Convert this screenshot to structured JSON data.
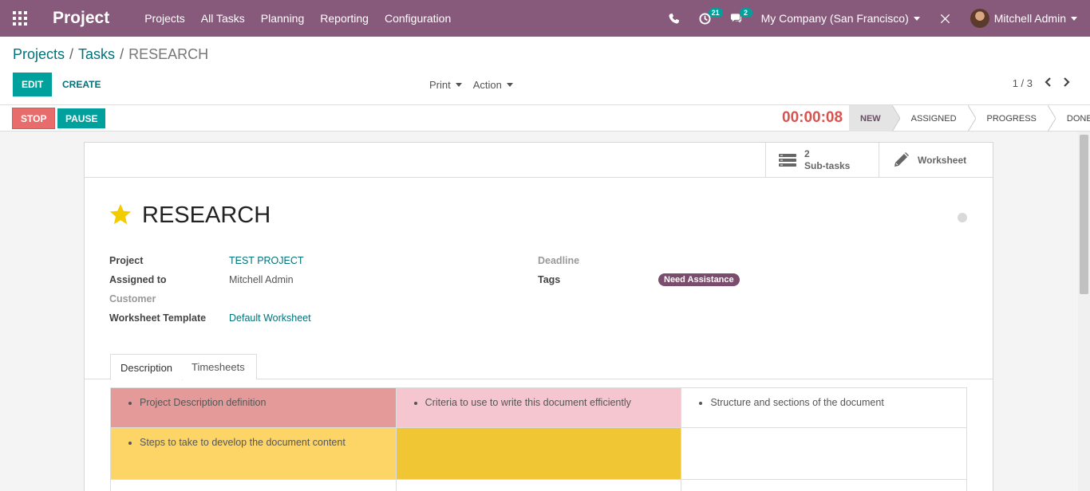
{
  "navbar": {
    "app_name": "Project",
    "menu": [
      "Projects",
      "All Tasks",
      "Planning",
      "Reporting",
      "Configuration"
    ],
    "activity_count": "21",
    "message_count": "2",
    "company": "My Company (San Francisco)",
    "user": "Mitchell Admin"
  },
  "breadcrumb": {
    "projects": "Projects",
    "tasks": "Tasks",
    "current": "RESEARCH",
    "sep": "/"
  },
  "toolbar": {
    "edit_label": "EDIT",
    "create_label": "CREATE",
    "print_label": "Print",
    "action_label": "Action",
    "pager": "1 / 3"
  },
  "statusbar": {
    "stop_label": "STOP",
    "pause_label": "PAUSE",
    "timer": "00:00:08",
    "stages": [
      "NEW",
      "ASSIGNED",
      "PROGRESS",
      "DONE"
    ],
    "active_stage": "NEW"
  },
  "smart_buttons": {
    "subtasks_count": "2",
    "subtasks_label": "Sub-tasks",
    "worksheet_label": "Worksheet"
  },
  "task": {
    "name": "RESEARCH",
    "fields": {
      "project_label": "Project",
      "project_value": "TEST PROJECT",
      "assigned_label": "Assigned to",
      "assigned_value": "Mitchell Admin",
      "customer_label": "Customer",
      "worksheet_label": "Worksheet Template",
      "worksheet_value": "Default Worksheet",
      "deadline_label": "Deadline",
      "tags_label": "Tags",
      "tag": "Need Assistance"
    }
  },
  "tabs": [
    "Description",
    "Timesheets"
  ],
  "description": {
    "cell1": "Project Description definition",
    "cell2": "Criteria to use to write this document efficiently",
    "cell3": "Structure and sections of the document",
    "cell4": "Steps to take to develop the document content"
  },
  "colors": {
    "navbar": "#875a7b",
    "primary": "#00a09d",
    "stop": "#e86c6c",
    "timer": "#d9534f",
    "tag": "#7b4d6c",
    "cell_red": "#e59a9a",
    "cell_pink": "#f5c6cf",
    "cell_yellow": "#fdd567",
    "cell_gold": "#f0c634"
  }
}
